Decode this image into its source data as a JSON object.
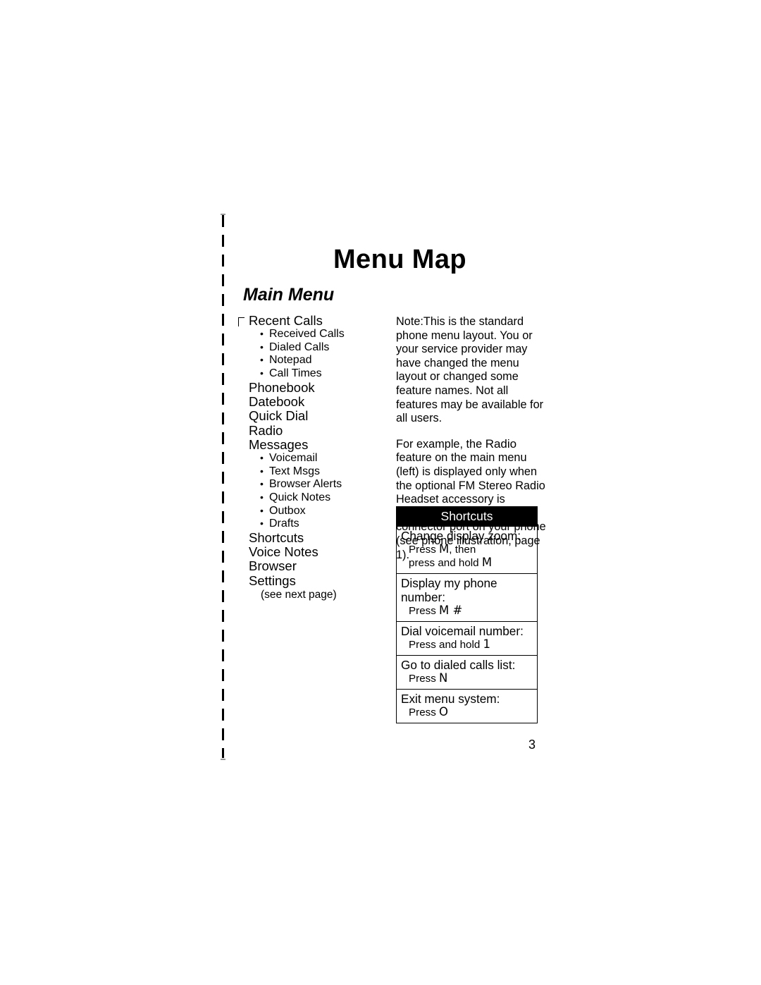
{
  "page": {
    "title": "Menu Map",
    "subtitle": "Main Menu",
    "page_number": "3"
  },
  "main_menu": [
    {
      "label": "Recent Calls",
      "children": [
        "Received Calls",
        "Dialed Calls",
        "Notepad",
        "Call Times"
      ]
    },
    {
      "label": "Phonebook",
      "children": []
    },
    {
      "label": "Datebook",
      "children": []
    },
    {
      "label": "Quick Dial",
      "children": []
    },
    {
      "label": "Radio",
      "children": []
    },
    {
      "label": "Messages",
      "children": [
        "Voicemail",
        "Text Msgs",
        "Browser Alerts",
        "Quick Notes",
        "Outbox",
        "Drafts"
      ]
    },
    {
      "label": "Shortcuts",
      "children": []
    },
    {
      "label": "Voice Notes",
      "children": []
    },
    {
      "label": "Browser",
      "children": []
    },
    {
      "label": "Settings",
      "children": []
    }
  ],
  "see_next_page": "(see next page)",
  "note": {
    "paragraph1_label": "Note:",
    "paragraph1": "This is the standard phone menu layout. You or your service provider may have changed the menu layout or changed some feature names. Not all features may be available for all users.",
    "paragraph2_part1": "For example, the ",
    "paragraph2_keyword": "Radio",
    "paragraph2_part2": " feature on the main menu (left) is displayed only when the optional FM Stereo Radio Headset accessory is plugged into the accessory connector port on your phone (see phone illustration, page 1)."
  },
  "shortcuts": {
    "header": "Shortcuts",
    "rows": [
      {
        "title": "Change display zoom:",
        "detail_line1_pre": "Press ",
        "detail_line1_key": "M",
        "detail_line1_post": ", then",
        "detail_line2_pre": "press and hold ",
        "detail_line2_key": "M",
        "detail_line2_post": ""
      },
      {
        "title": "Display my phone number:",
        "detail_line1_pre": "Press ",
        "detail_line1_key": "M #",
        "detail_line1_post": "",
        "detail_line2_pre": "",
        "detail_line2_key": "",
        "detail_line2_post": ""
      },
      {
        "title": "Dial voicemail number:",
        "detail_line1_pre": "Press and hold ",
        "detail_line1_key": "1",
        "detail_line1_post": "",
        "detail_line2_pre": "",
        "detail_line2_key": "",
        "detail_line2_post": ""
      },
      {
        "title": "Go to dialed calls list:",
        "detail_line1_pre": "Press ",
        "detail_line1_key": "N",
        "detail_line1_post": "",
        "detail_line2_pre": "",
        "detail_line2_key": "",
        "detail_line2_post": ""
      },
      {
        "title": "Exit menu system:",
        "detail_line1_pre": "Press ",
        "detail_line1_key": "O",
        "detail_line1_post": "",
        "detail_line2_pre": "",
        "detail_line2_key": "",
        "detail_line2_post": ""
      }
    ]
  }
}
